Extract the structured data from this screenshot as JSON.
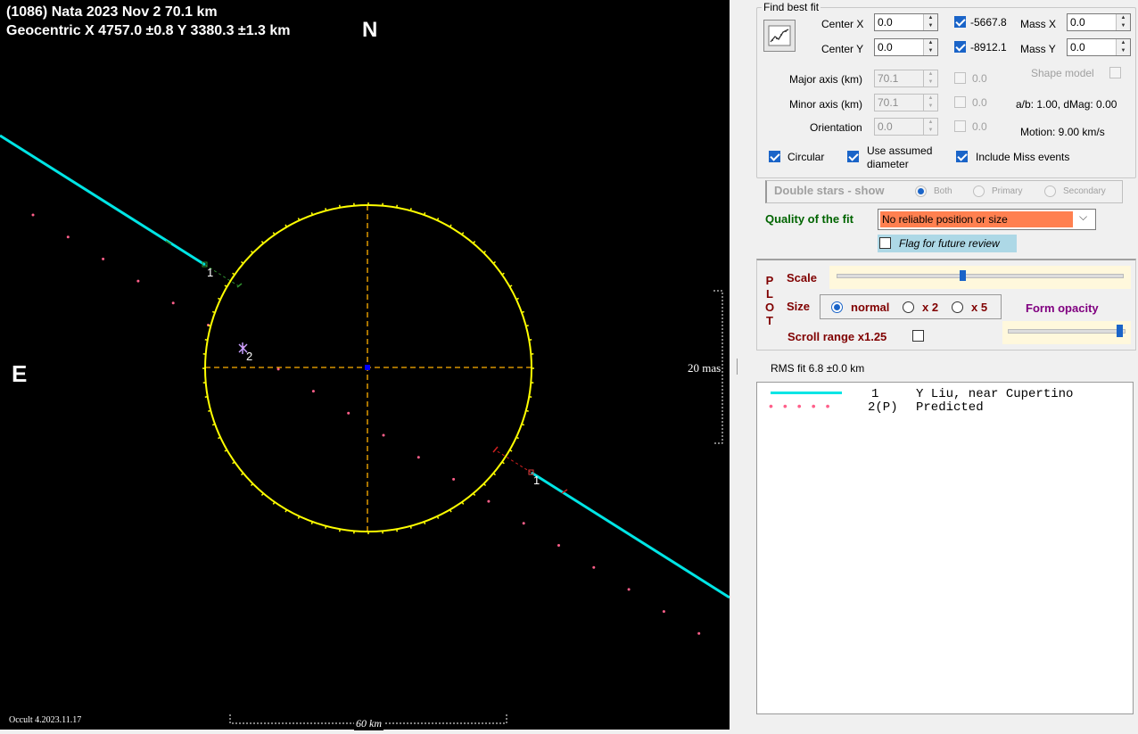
{
  "plot": {
    "title_line1": "(1086) Nata  2023 Nov 2   70.1 km",
    "title_line2": "Geocentric  X  4757.0 ±0.8  Y  3380.3 ±1.3 km",
    "north_label": "N",
    "east_label": "E",
    "version": "Occult 4.2023.11.17",
    "scale_km_label": "60 km",
    "scale_mas_label": "20 mas",
    "chord1_label": "1",
    "chord2_label": "2",
    "colors": {
      "background": "#000000",
      "ellipse": "#ffff00",
      "observed_chord": "#00e5e5",
      "predicted": "#ff5f8a",
      "axes": "#ffb000",
      "center": "#0000ff"
    }
  },
  "panel": {
    "find_best_fit": "Find best fit",
    "fit_button_icon": "line-chart-icon",
    "center_x_label": "Center X",
    "center_x_value": "0.0",
    "center_y_label": "Center Y",
    "center_y_value": "0.0",
    "center_x_fixed": "-5667.8",
    "center_y_fixed": "-8912.1",
    "mass_x_label": "Mass X",
    "mass_x_value": "0.0",
    "mass_y_label": "Mass Y",
    "mass_y_value": "0.0",
    "major_label": "Major axis (km)",
    "major_value": "70.1",
    "major_fixed": "0.0",
    "minor_label": "Minor axis (km)",
    "minor_value": "70.1",
    "minor_fixed": "0.0",
    "orient_label": "Orientation",
    "orient_value": "0.0",
    "orient_fixed": "0.0",
    "shape_model": "Shape model",
    "ab_dmag": "a/b: 1.00, dMag: 0.00",
    "motion": "Motion: 9.00 km/s",
    "circular": "Circular",
    "use_assumed_1": "Use assumed",
    "use_assumed_2": "diameter",
    "include_miss": "Include Miss events",
    "double_stars": "Double stars - show",
    "both": "Both",
    "primary": "Primary",
    "secondary": "Secondary",
    "quality_label": "Quality of the fit",
    "quality_value": "No reliable position or size",
    "flag_review": "Flag for future review",
    "plot_letters": [
      "P",
      "L",
      "O",
      "T"
    ],
    "scale_label": "Scale",
    "size_label": "Size",
    "size_normal": "normal",
    "size_x2": "x 2",
    "size_x5": "x 5",
    "form_opacity": "Form opacity",
    "scroll_range": "Scroll range x1.25",
    "rms_fit": "RMS fit 6.8 ±0.0 km",
    "legend": [
      {
        "num": "1",
        "name": "Y Liu, near Cupertino"
      },
      {
        "num": "2(P)",
        "name": "Predicted"
      }
    ],
    "colors": {
      "quality_bg": "#ff8050",
      "quality_text": "#006400",
      "plot_label": "#800000",
      "form_opacity": "#800080",
      "flag_bg": "#add8e6",
      "slider_bg": "#fff8dc"
    }
  }
}
